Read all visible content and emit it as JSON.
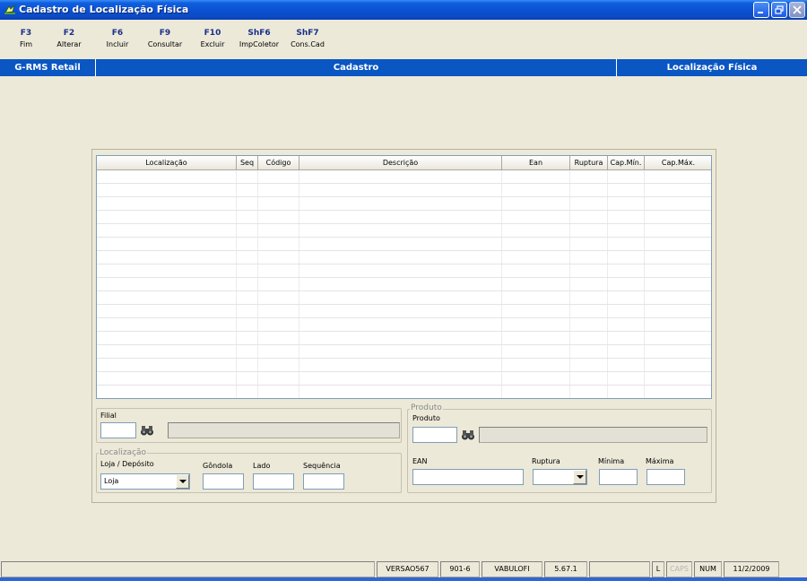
{
  "window": {
    "title": "Cadastro de Localização Física"
  },
  "toolbar": {
    "buttons": [
      {
        "key": "F3",
        "label": "Fim"
      },
      {
        "key": "F2",
        "label": "Alterar"
      },
      {
        "key": "F6",
        "label": "Incluir"
      },
      {
        "key": "F9",
        "label": "Consultar"
      },
      {
        "key": "F10",
        "label": "Excluir"
      },
      {
        "key": "ShF6",
        "label": "ImpColetor"
      },
      {
        "key": "ShF7",
        "label": "Cons.Cad"
      }
    ]
  },
  "header_band": {
    "app": "G-RMS Retail",
    "section": "Cadastro",
    "screen": "Localização Física"
  },
  "grid": {
    "columns": [
      "Localização",
      "Seq",
      "Código",
      "Descrição",
      "Ean",
      "Ruptura",
      "Cap.Mín.",
      "Cap.Máx."
    ],
    "rows": []
  },
  "filial": {
    "label": "Filial",
    "value": ""
  },
  "localizacao": {
    "legend": "Localização",
    "loja_label": "Loja / Depósito",
    "loja_value": "Loja",
    "gondola_label": "Gôndola",
    "lado_label": "Lado",
    "sequencia_label": "Sequência"
  },
  "produto": {
    "legend": "Produto",
    "produto_label": "Produto",
    "ean_label": "EAN",
    "ruptura_label": "Ruptura",
    "minima_label": "Mínima",
    "maxima_label": "Máxima"
  },
  "statusbar": {
    "version": "VERSAO567",
    "code": "901-6",
    "user": "VABULOFI",
    "build": "5.67.1",
    "l": "L",
    "caps": "CAPS",
    "num": "NUM",
    "date": "11/2/2009"
  }
}
